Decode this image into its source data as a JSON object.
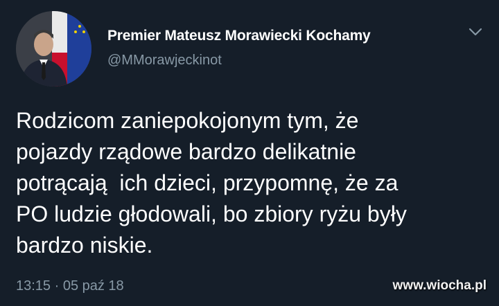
{
  "author": {
    "display_name": "Premier Mateusz Morawiecki Kochamy",
    "handle": "@MMorawjeckinot"
  },
  "menu": {
    "icon": "chevron-down-icon"
  },
  "tweet": {
    "lines": [
      "Rodzicom zaniepokojonym tym, że",
      "pojazdy rządowe bardzo delikatnie",
      "potrącają  ich dzieci, przypomnę, że za",
      "PO ludzie głodowali, bo zbiory ryżu były",
      "bardzo niskie."
    ],
    "timestamp": "13:15 · 05 paź 18"
  },
  "watermark": "www.wiocha.pl",
  "colors": {
    "background": "#151e29",
    "primary_text": "#ffffff",
    "secondary_text": "#8899a6"
  }
}
